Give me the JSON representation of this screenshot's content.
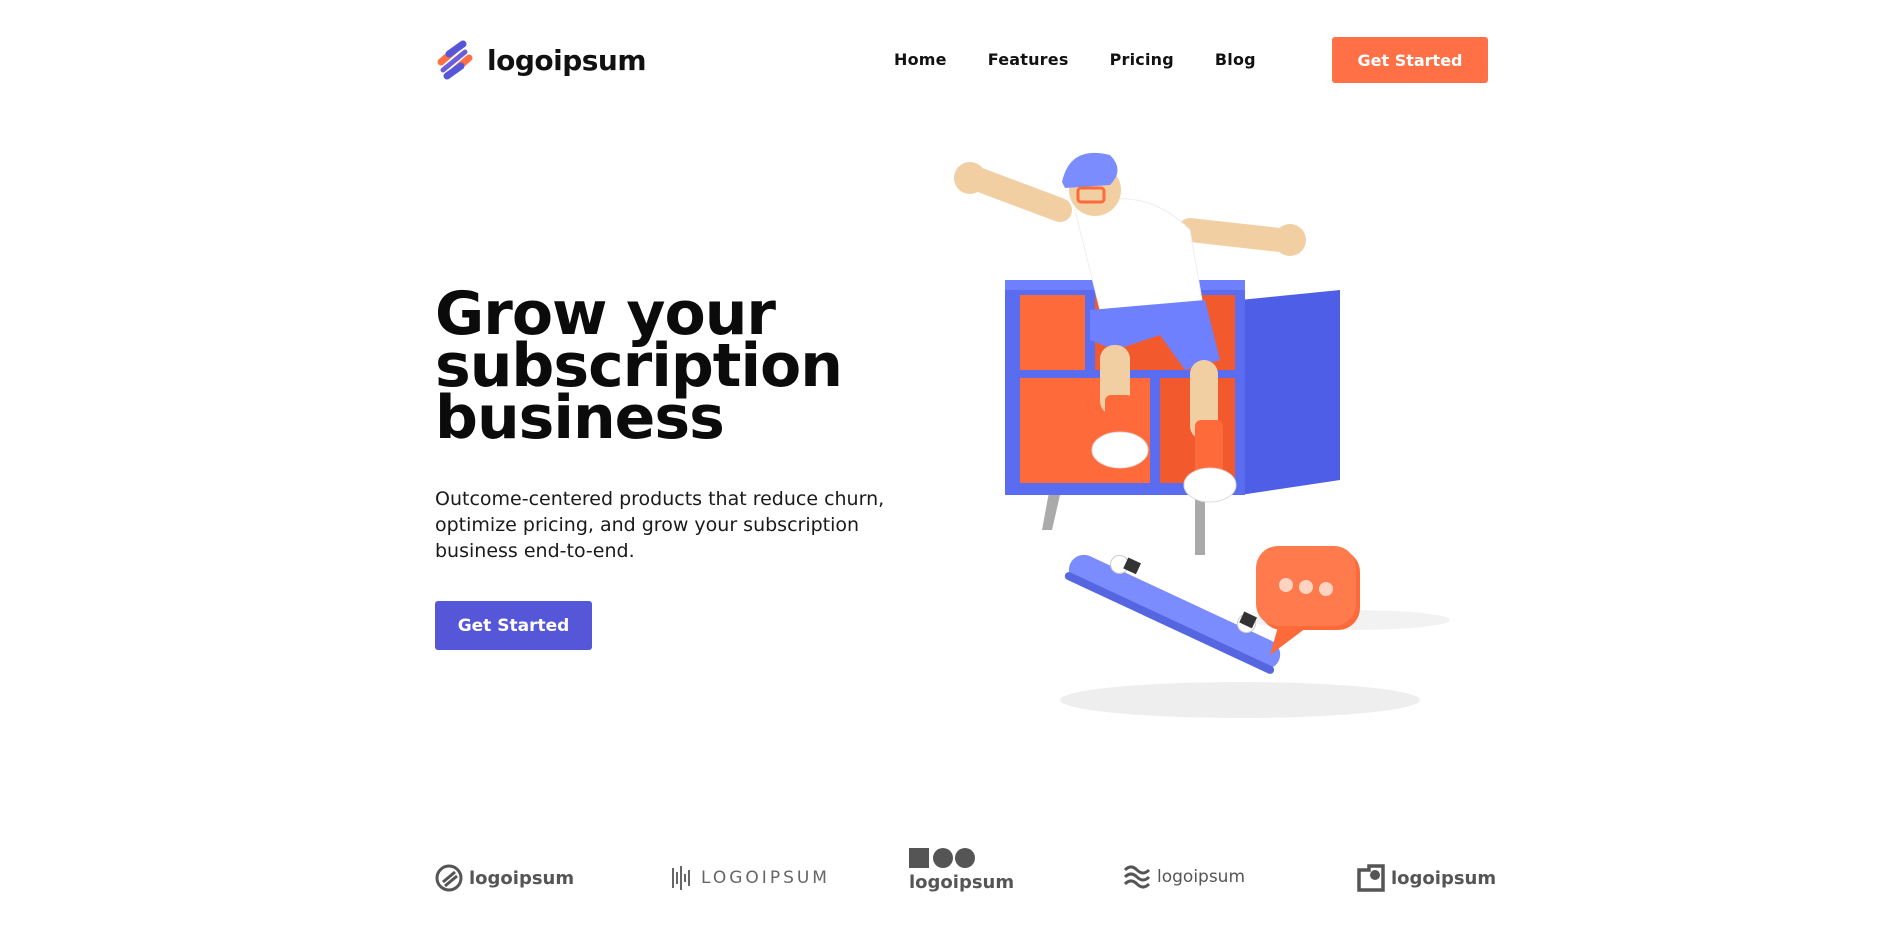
{
  "header": {
    "brand_name": "logoipsum",
    "nav": [
      {
        "label": "Home"
      },
      {
        "label": "Features"
      },
      {
        "label": "Pricing"
      },
      {
        "label": "Blog"
      }
    ],
    "cta_label": "Get Started",
    "cta_color": "#ff7046"
  },
  "hero": {
    "title_lines": [
      "Grow your",
      "subscription",
      "business"
    ],
    "subtitle": "Outcome-centered products that reduce churn, optimize pricing, and grow your subscription business end-to-end.",
    "cta_label": "Get Started",
    "cta_color": "#5557d8"
  },
  "illustration": {
    "description_icon": "skateboarder-illustration"
  },
  "partner_logos": [
    {
      "name": "logoipsum",
      "icon": "circle-slash-icon"
    },
    {
      "name": "LOGOIPSUM",
      "icon": "soundwave-icon"
    },
    {
      "name": "logoipsum",
      "icon": "square-circles-icon"
    },
    {
      "name": "logoipsum",
      "icon": "waves-icon"
    },
    {
      "name": "logoipsum",
      "icon": "square-notch-icon"
    }
  ]
}
